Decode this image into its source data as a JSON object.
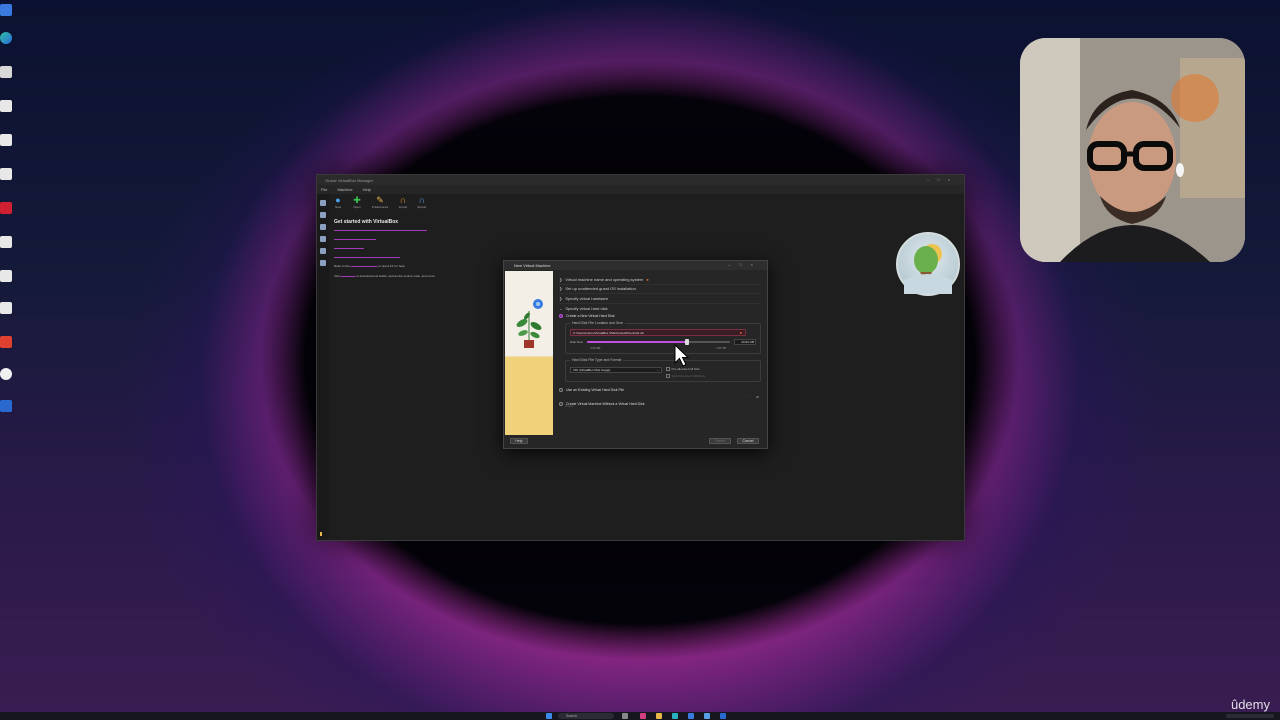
{
  "vbox": {
    "title": "Oracle VirtualBox Manager",
    "menu": [
      "File",
      "Machine",
      "Help"
    ],
    "toolbar": [
      "New",
      "Open",
      "Preferences",
      "Import",
      "Export"
    ],
    "welcome_title": "Get started with VirtualBox",
    "welcome_line_refer_prefix": "Refer to the",
    "welcome_line_refer_suffix": "or press F1 for help.",
    "welcome_line_visit_prefix": "Visit",
    "welcome_line_visit_suffix": "to download test builds, access the source code, and more."
  },
  "dialog": {
    "title": "New Virtual Machine",
    "sections": [
      "Virtual machine name and operating system",
      "Set up unattended guest OS installation",
      "Specify virtual hardware",
      "Specify virtual hard disk"
    ],
    "create_new_disk_label": "Create a New Virtual Hard Disk",
    "location_group_label": "Hard Disk File Location and Size",
    "path_value": "C:\\Users\\marco\\VirtualBox VMs\\Centos9\\Centos9.vdi",
    "disk_size_label": "Disk Size:",
    "disk_size_value": "20.00 GB",
    "slider_min": "4.00 MB",
    "slider_max": "2.00 TB",
    "slider_level": 0.7,
    "type_group_label": "Hard Disk File Type and Format",
    "format_value": "VDI (VirtualBox Disk Image)",
    "preallocate_label": "Pre-allocate Full Size",
    "split_label": "Split Disk into 2 GB Parts",
    "use_existing_label": "Use an Existing Virtual Hard Disk File",
    "existing_placeholder": "Empty",
    "no_disk_label": "Create Virtual Machine Without a Virtual Hard Disk",
    "help_button": "Help",
    "finish_button": "Finish",
    "cancel_button": "Cancel"
  },
  "taskbar": {
    "search_placeholder": "Search"
  },
  "watermark": "ûdemy",
  "colors": {
    "accent": "#c050e0",
    "error_field": "#7a3040",
    "window_bg": "#1e1e1e"
  }
}
